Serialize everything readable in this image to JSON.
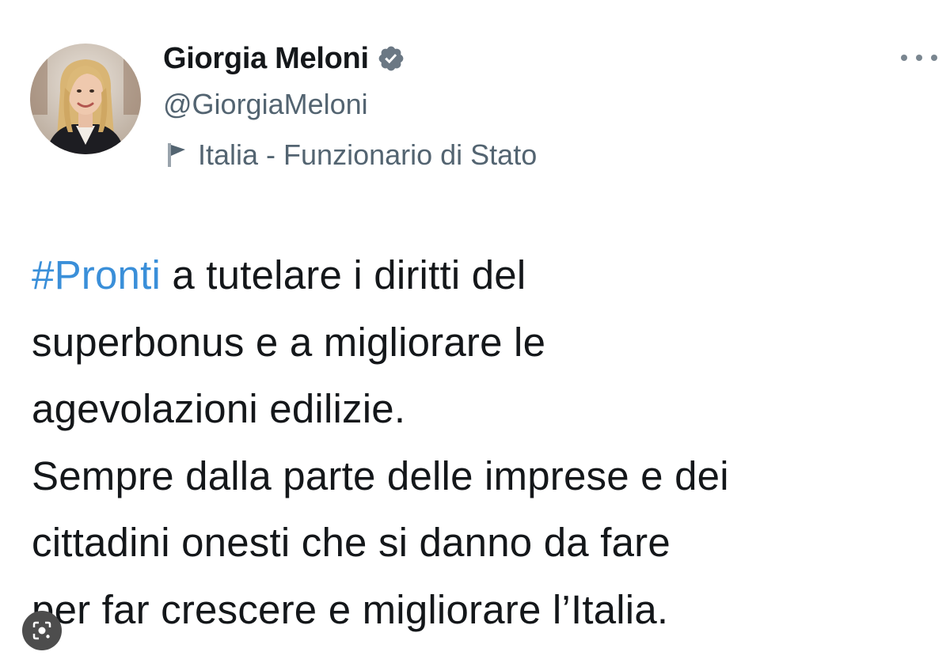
{
  "author": {
    "display_name": "Giorgia Meloni",
    "handle": "@GiorgiaMeloni",
    "verified": true,
    "label": "Italia - Funzionario di Stato",
    "avatar_icon": "person-portrait",
    "verified_icon": "verified-badge-icon",
    "label_icon": "flag-icon"
  },
  "tweet": {
    "hashtag": "#Pronti",
    "lines": [
      " a tutelare i diritti del",
      "superbonus e a migliorare le",
      "agevolazioni edilizie.",
      "Sempre dalla parte delle imprese e dei",
      "cittadini onesti che si danno da fare",
      "per far crescere e migliorare l’Italia."
    ]
  },
  "colors": {
    "text": "#14171a",
    "secondary": "#536471",
    "hashtag": "#3a8fd9",
    "verified_badge": "#6b7884"
  },
  "overlay": {
    "lens_icon": "image-search-icon"
  }
}
